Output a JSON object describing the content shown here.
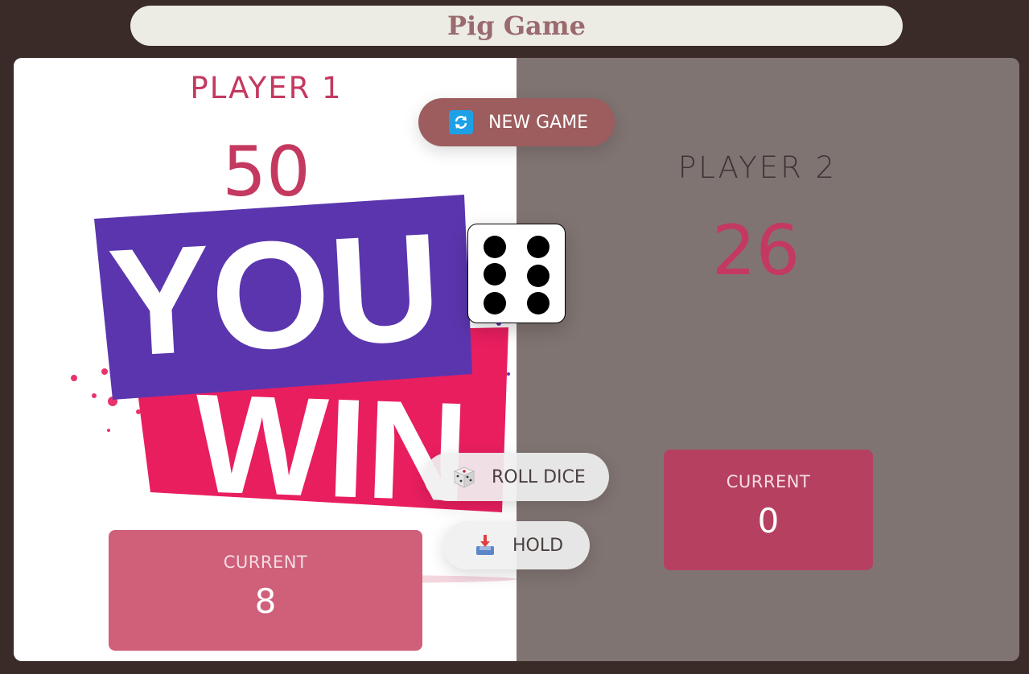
{
  "app": {
    "title": "Pig Game"
  },
  "player1": {
    "name": "PLAYER 1",
    "score": "50",
    "current_label": "CURRENT",
    "current_value": "8",
    "banner_line1": "YOU",
    "banner_line2": "WIN"
  },
  "player2": {
    "name": "PLAYER 2",
    "score": "26",
    "current_label": "CURRENT",
    "current_value": "0"
  },
  "controls": {
    "new_game": "NEW GAME",
    "roll_dice": "ROLL DICE",
    "hold": "HOLD"
  },
  "dice": {
    "value": 6
  },
  "colors": {
    "accent": "#c4395f",
    "background": "#3a2a28",
    "inactive_panel": "#807472",
    "new_game_btn": "#9d5c5d"
  }
}
